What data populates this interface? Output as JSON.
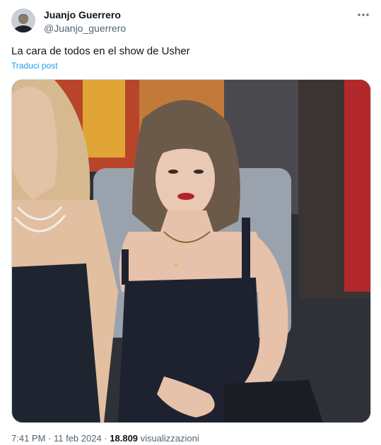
{
  "author": {
    "name": "Juanjo Guerrero",
    "handle": "@Juanjo_guerrero"
  },
  "tweet": {
    "text": "La cara de todos en el show de Usher",
    "translate_label": "Traduci post"
  },
  "icons": {
    "more": "more-horizontal-icon",
    "avatar": "profile-avatar"
  },
  "meta": {
    "time": "7:41 PM",
    "sep1": " · ",
    "date": "11 feb 2024",
    "sep2": " · ",
    "views_count": "18.809",
    "views_label": " visualizzazioni"
  },
  "colors": {
    "text": "#0f1419",
    "secondary": "#536471",
    "link": "#1d9bf0",
    "border": "#cfd9de"
  }
}
